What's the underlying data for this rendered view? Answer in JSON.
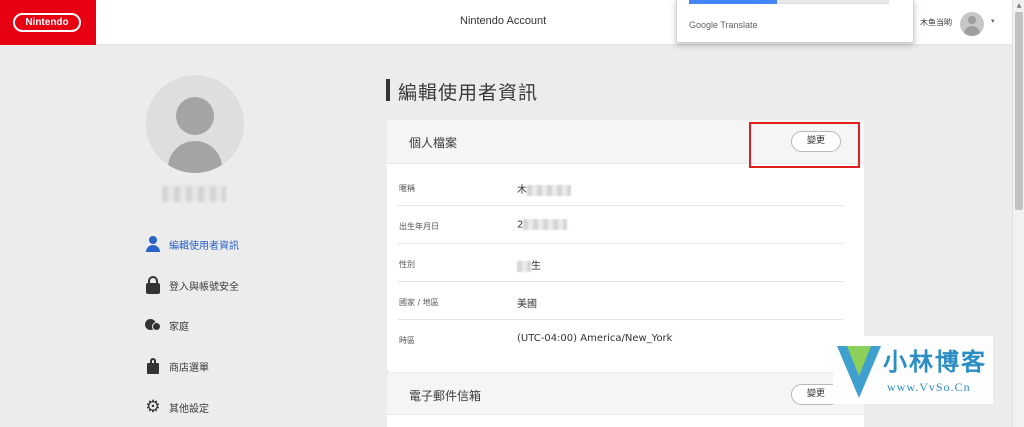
{
  "header": {
    "logo_text": "Nintendo",
    "title": "Nintendo Account",
    "user_name": "木鱼当哟",
    "caret": "▾"
  },
  "translate_popup": {
    "label": "Google Translate"
  },
  "sidebar": {
    "items": [
      {
        "label": "編輯使用者資訊",
        "icon": "person-icon",
        "active": true
      },
      {
        "label": "登入與帳號安全",
        "icon": "lock-icon",
        "active": false
      },
      {
        "label": "家庭",
        "icon": "family-icon",
        "active": false
      },
      {
        "label": "商店選單",
        "icon": "shopping-bag-icon",
        "active": false
      },
      {
        "label": "其他設定",
        "icon": "gear-icon",
        "active": false
      }
    ]
  },
  "main": {
    "page_title": "編輯使用者資訊",
    "profile_card": {
      "title": "個人檔案",
      "change_label": "變更",
      "rows": [
        {
          "label": "暱稱",
          "value": "木"
        },
        {
          "label": "出生年月日",
          "value": "2"
        },
        {
          "label": "性別",
          "value": "生"
        },
        {
          "label": "國家 / 地區",
          "value": "美國"
        },
        {
          "label": "時區",
          "value": "(UTC-04:00) America/New_York"
        }
      ]
    },
    "email_card": {
      "title": "電子郵件信箱",
      "change_label": "變更"
    }
  },
  "watermark": {
    "title": "小林博客",
    "url": "www.VvSo.Cn"
  },
  "colors": {
    "brand_red": "#e60012",
    "active_blue": "#2a62c9",
    "highlight_red": "#e02020"
  }
}
